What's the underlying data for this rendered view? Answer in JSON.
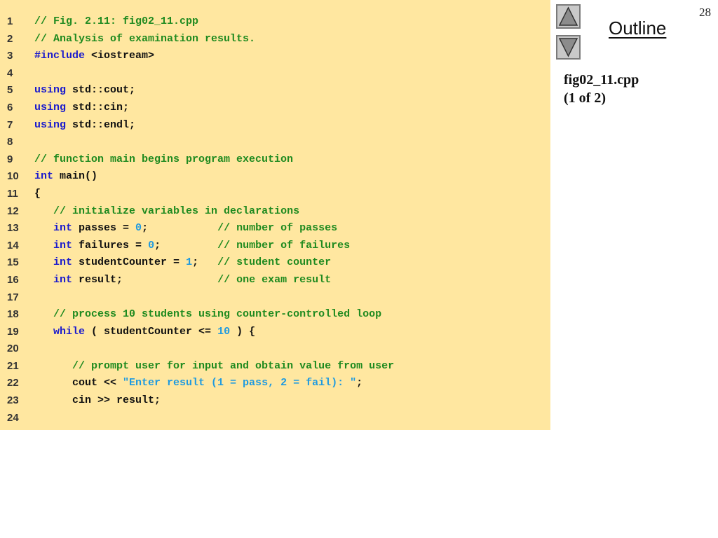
{
  "page_number": "28",
  "outline": {
    "title": "Outline",
    "nav_up_icon": "triangle-up-icon",
    "nav_down_icon": "triangle-down-icon",
    "filename": "fig02_11.cpp",
    "part": "(1 of 2)"
  },
  "colors": {
    "code_background": "#ffe7a0",
    "comment": "#1f8a1f",
    "keyword": "#1a1acd",
    "literal": "#1e9ae0",
    "plain": "#111111"
  },
  "code": {
    "lines": [
      {
        "no": "1",
        "tokens": [
          {
            "t": "comment",
            "v": "// Fig. 2.11: fig02_11.cpp"
          }
        ]
      },
      {
        "no": "2",
        "tokens": [
          {
            "t": "comment",
            "v": "// Analysis of examination results."
          }
        ]
      },
      {
        "no": "3",
        "tokens": [
          {
            "t": "keyword",
            "v": "#include"
          },
          {
            "t": "plain",
            "v": " <iostream>"
          }
        ]
      },
      {
        "no": "4",
        "tokens": []
      },
      {
        "no": "5",
        "tokens": [
          {
            "t": "keyword",
            "v": "using"
          },
          {
            "t": "plain",
            "v": " std::cout;"
          }
        ]
      },
      {
        "no": "6",
        "tokens": [
          {
            "t": "keyword",
            "v": "using"
          },
          {
            "t": "plain",
            "v": " std::cin;"
          }
        ]
      },
      {
        "no": "7",
        "tokens": [
          {
            "t": "keyword",
            "v": "using"
          },
          {
            "t": "plain",
            "v": " std::endl;"
          }
        ]
      },
      {
        "no": "8",
        "tokens": []
      },
      {
        "no": "9",
        "tokens": [
          {
            "t": "comment",
            "v": "// function main begins program execution"
          }
        ]
      },
      {
        "no": "10",
        "tokens": [
          {
            "t": "keyword",
            "v": "int"
          },
          {
            "t": "plain",
            "v": " main()"
          }
        ]
      },
      {
        "no": "11",
        "tokens": [
          {
            "t": "plain",
            "v": "{"
          }
        ]
      },
      {
        "no": "12",
        "tokens": [
          {
            "t": "plain",
            "v": "   "
          },
          {
            "t": "comment",
            "v": "// initialize variables in declarations"
          }
        ]
      },
      {
        "no": "13",
        "tokens": [
          {
            "t": "plain",
            "v": "   "
          },
          {
            "t": "keyword",
            "v": "int"
          },
          {
            "t": "plain",
            "v": " passes = "
          },
          {
            "t": "number",
            "v": "0"
          },
          {
            "t": "plain",
            "v": ";           "
          },
          {
            "t": "comment",
            "v": "// number of passes"
          }
        ]
      },
      {
        "no": "14",
        "tokens": [
          {
            "t": "plain",
            "v": "   "
          },
          {
            "t": "keyword",
            "v": "int"
          },
          {
            "t": "plain",
            "v": " failures = "
          },
          {
            "t": "number",
            "v": "0"
          },
          {
            "t": "plain",
            "v": ";         "
          },
          {
            "t": "comment",
            "v": "// number of failures"
          }
        ]
      },
      {
        "no": "15",
        "tokens": [
          {
            "t": "plain",
            "v": "   "
          },
          {
            "t": "keyword",
            "v": "int"
          },
          {
            "t": "plain",
            "v": " studentCounter = "
          },
          {
            "t": "number",
            "v": "1"
          },
          {
            "t": "plain",
            "v": ";   "
          },
          {
            "t": "comment",
            "v": "// student counter"
          }
        ]
      },
      {
        "no": "16",
        "tokens": [
          {
            "t": "plain",
            "v": "   "
          },
          {
            "t": "keyword",
            "v": "int"
          },
          {
            "t": "plain",
            "v": " result;               "
          },
          {
            "t": "comment",
            "v": "// one exam result"
          }
        ]
      },
      {
        "no": "17",
        "tokens": []
      },
      {
        "no": "18",
        "tokens": [
          {
            "t": "plain",
            "v": "   "
          },
          {
            "t": "comment",
            "v": "// process 10 students using counter-controlled loop"
          }
        ]
      },
      {
        "no": "19",
        "tokens": [
          {
            "t": "plain",
            "v": "   "
          },
          {
            "t": "keyword",
            "v": "while"
          },
          {
            "t": "plain",
            "v": " ( studentCounter <= "
          },
          {
            "t": "number",
            "v": "10"
          },
          {
            "t": "plain",
            "v": " ) {"
          }
        ]
      },
      {
        "no": "20",
        "tokens": []
      },
      {
        "no": "21",
        "tokens": [
          {
            "t": "plain",
            "v": "      "
          },
          {
            "t": "comment",
            "v": "// prompt user for input and obtain value from user"
          }
        ]
      },
      {
        "no": "22",
        "tokens": [
          {
            "t": "plain",
            "v": "      cout << "
          },
          {
            "t": "string",
            "v": "\"Enter result (1 = pass, 2 = fail): \""
          },
          {
            "t": "plain",
            "v": ";"
          }
        ]
      },
      {
        "no": "23",
        "tokens": [
          {
            "t": "plain",
            "v": "      cin >> result;"
          }
        ]
      },
      {
        "no": "24",
        "tokens": []
      }
    ]
  }
}
